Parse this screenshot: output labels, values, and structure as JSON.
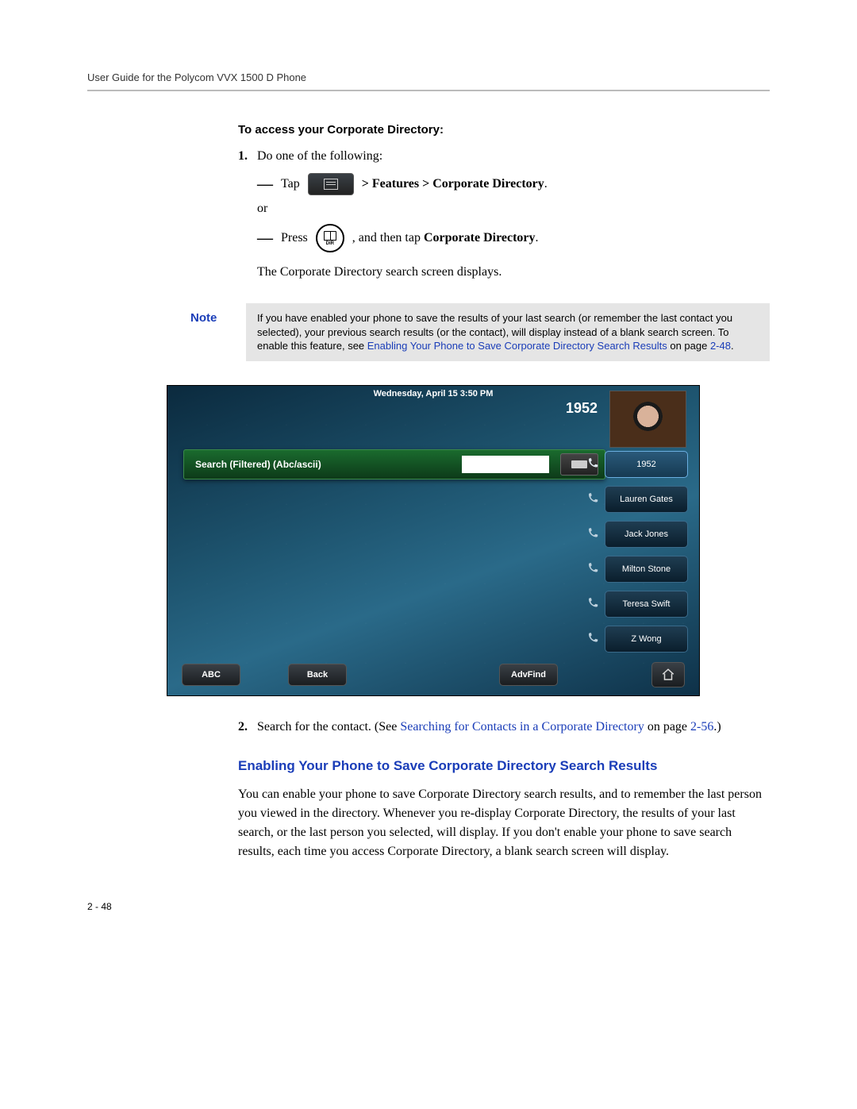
{
  "header": "User Guide for the Polycom VVX 1500 D Phone",
  "section1_title": "To access your Corporate Directory:",
  "step1": {
    "num": "1.",
    "text": "Do one of the following:"
  },
  "bullet1": {
    "tap": "Tap",
    "path": "> Features > Corporate Directory",
    "end": "."
  },
  "or": "or",
  "bullet2": {
    "press": "Press",
    "mid": ", and then tap ",
    "bold": "Corporate Directory",
    "end": "."
  },
  "result_line": "The Corporate Directory search screen displays.",
  "note": {
    "label": "Note",
    "body_pre": "If you have enabled your phone to save the results of your last search (or remember the last contact you selected), your previous search results (or the contact), will display instead of a blank search screen. To enable this feature, see ",
    "link": "Enabling Your Phone to Save Corporate Directory Search Results",
    "body_mid": " on page ",
    "page": "2-48",
    "end": "."
  },
  "phone": {
    "date": "Wednesday, April 15  3:50 PM",
    "ext": "1952",
    "search_label": "Search (Filtered) (Abc/ascii)",
    "contacts": [
      "1952",
      "Lauren Gates",
      "Jack Jones",
      "Milton Stone",
      "Teresa Swift",
      "Z Wong"
    ],
    "softkeys": [
      "ABC",
      "Back",
      "AdvFind"
    ]
  },
  "step2": {
    "num": "2.",
    "pre": "Search for the contact. (See ",
    "link": "Searching for Contacts in a Corporate Directory",
    "mid": " on page ",
    "page": "2-56",
    "end": ".)"
  },
  "heading2": "Enabling Your Phone to Save Corporate Directory Search Results",
  "para2": "You can enable your phone to save Corporate Directory search results, and to remember the last person you viewed in the directory. Whenever you re-display Corporate Directory, the results of your last search, or the last person you selected, will display. If you don't enable your phone to save search results, each time you access Corporate Directory, a blank search screen will display.",
  "pagenum": "2 - 48"
}
